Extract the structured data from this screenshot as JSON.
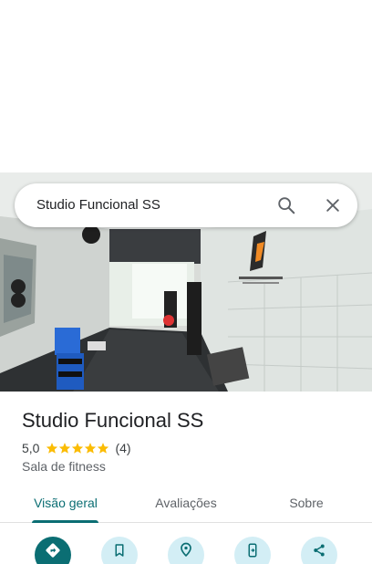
{
  "search": {
    "query": "Studio Funcional SS"
  },
  "place": {
    "title": "Studio Funcional SS",
    "rating": 5.0,
    "rating_text": "5,0",
    "review_count_text": "(4)",
    "stars": 5,
    "category": "Sala de fitness"
  },
  "tabs": [
    {
      "label": "Visão geral",
      "active": true
    },
    {
      "label": "Avaliações",
      "active": false
    },
    {
      "label": "Sobre",
      "active": false
    }
  ],
  "actions": [
    {
      "icon": "directions-icon"
    },
    {
      "icon": "bookmark-icon"
    },
    {
      "icon": "nearby-pin-icon"
    },
    {
      "icon": "send-to-phone-icon"
    },
    {
      "icon": "share-icon"
    }
  ],
  "colors": {
    "accent": "#0b6e73",
    "star": "#fbbc04",
    "action_bg": "#d3eef5"
  }
}
